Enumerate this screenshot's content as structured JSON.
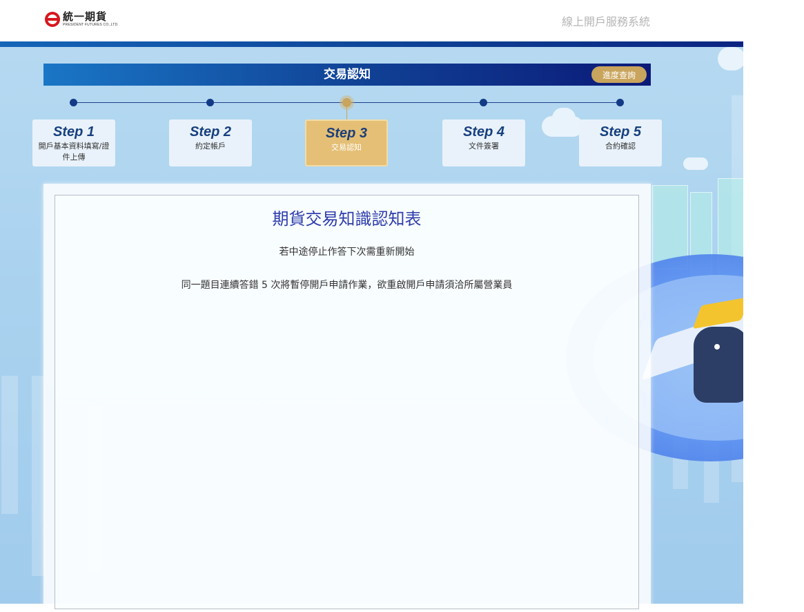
{
  "header": {
    "logo_cn": "統一期貨",
    "logo_en": "PRESIDENT FUTURES CO.,LTD.",
    "system_title": "線上開戶服務系統"
  },
  "banner": {
    "title": "交易認知",
    "progress_button": "進度查詢"
  },
  "steps": [
    {
      "num": "Step 1",
      "label": "開戶基本資料填寫/證件上傳",
      "active": false
    },
    {
      "num": "Step 2",
      "label": "約定帳戶",
      "active": false
    },
    {
      "num": "Step 3",
      "label": "交易認知",
      "active": true
    },
    {
      "num": "Step 4",
      "label": "文件簽署",
      "active": false
    },
    {
      "num": "Step 5",
      "label": "合約確認",
      "active": false
    }
  ],
  "form": {
    "title": "期貨交易知識認知表",
    "notice_1": "若中途停止作答下次需重新開始",
    "notice_2": "同一題目連續答錯 5 次將暫停開戶申請作業，欲重啟開戶申請須洽所屬營業員"
  },
  "colors": {
    "brand_blue": "#103f93",
    "accent_gold": "#c9a45c",
    "title_text": "#2f3dab"
  }
}
